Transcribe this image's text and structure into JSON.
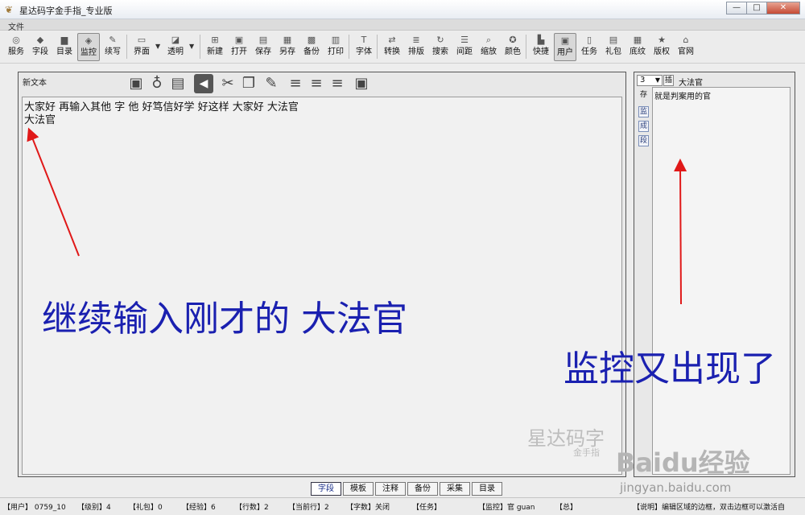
{
  "window": {
    "title": "星达码字金手指_专业版",
    "controls": {
      "minimize": "—",
      "maximize": "□",
      "close": "✕"
    }
  },
  "menu": {
    "file": "文件"
  },
  "toolbar": {
    "items": [
      {
        "label": "服务",
        "icon": "rss-icon",
        "glyph": "◎"
      },
      {
        "label": "字段",
        "icon": "diamond-icon",
        "glyph": "◆"
      },
      {
        "label": "目录",
        "icon": "folder-icon",
        "glyph": "▆"
      },
      {
        "label": "监控",
        "icon": "monitor-icon",
        "glyph": "◈"
      },
      {
        "label": "续写",
        "icon": "pen-icon",
        "glyph": "✎"
      },
      {
        "label": "界面",
        "icon": "window-icon",
        "glyph": "▭"
      },
      {
        "label": "透明",
        "icon": "opacity-icon",
        "glyph": "◪"
      },
      {
        "label": "新建",
        "icon": "new-icon",
        "glyph": "⊞"
      },
      {
        "label": "打开",
        "icon": "open-icon",
        "glyph": "▣"
      },
      {
        "label": "保存",
        "icon": "save-icon",
        "glyph": "▤"
      },
      {
        "label": "另存",
        "icon": "save-as-icon",
        "glyph": "▦"
      },
      {
        "label": "备份",
        "icon": "backup-icon",
        "glyph": "▩"
      },
      {
        "label": "打印",
        "icon": "print-icon",
        "glyph": "▥"
      },
      {
        "label": "字体",
        "icon": "font-icon",
        "glyph": "T"
      },
      {
        "label": "转换",
        "icon": "convert-icon",
        "glyph": "⇄"
      },
      {
        "label": "排版",
        "icon": "layout-icon",
        "glyph": "≣"
      },
      {
        "label": "搜索",
        "icon": "refresh-icon",
        "glyph": "↻"
      },
      {
        "label": "间距",
        "icon": "spacing-icon",
        "glyph": "☰"
      },
      {
        "label": "缩放",
        "icon": "zoom-icon",
        "glyph": "⌕"
      },
      {
        "label": "颜色",
        "icon": "color-icon",
        "glyph": "✪"
      },
      {
        "label": "快捷",
        "icon": "shortcut-icon",
        "glyph": "▙"
      },
      {
        "label": "用户",
        "icon": "user-icon",
        "glyph": "▣"
      },
      {
        "label": "任务",
        "icon": "task-icon",
        "glyph": "▯"
      },
      {
        "label": "礼包",
        "icon": "gift-icon",
        "glyph": "▤"
      },
      {
        "label": "底纹",
        "icon": "pattern-icon",
        "glyph": "▦"
      },
      {
        "label": "版权",
        "icon": "star-icon",
        "glyph": "★"
      },
      {
        "label": "官网",
        "icon": "home-icon",
        "glyph": "⌂"
      }
    ]
  },
  "editor": {
    "doc_title": "新文本",
    "lines": [
      "大家好 再输入其他 字 他 好笃信好学 好这样 大家好 大法官",
      "大法官"
    ]
  },
  "right_panel": {
    "count_value": "3",
    "insert_label": "插",
    "word": "大法官",
    "side_tabs": [
      "存",
      "监",
      "成",
      "段"
    ],
    "hint": "就是判案用的官"
  },
  "bottom_tabs": [
    "字段",
    "模板",
    "注释",
    "备份",
    "采集",
    "目录"
  ],
  "status": {
    "user": "【用户】 0759_10",
    "level": "【级别】4",
    "gift": "【礼包】0",
    "exp": "【经验】6",
    "lines": "【行数】2",
    "current_line": "【当前行】2",
    "chars": "【字数】关闭",
    "task": "【任务】",
    "monitor": "【监控】官 guan",
    "total": "【总】",
    "note": "【说明】编辑区域的边框，双击边框可以激活自"
  },
  "annotations": {
    "left": "继续输入刚才的 大法官",
    "right": "监控又出现了"
  },
  "watermark": {
    "brand": "星达码字",
    "sub": "金手指",
    "baidu": "Baidu经验",
    "url": "jingyan.baidu.com"
  },
  "colors": {
    "annotation": "#1a20b0",
    "arrow": "#e01818"
  }
}
